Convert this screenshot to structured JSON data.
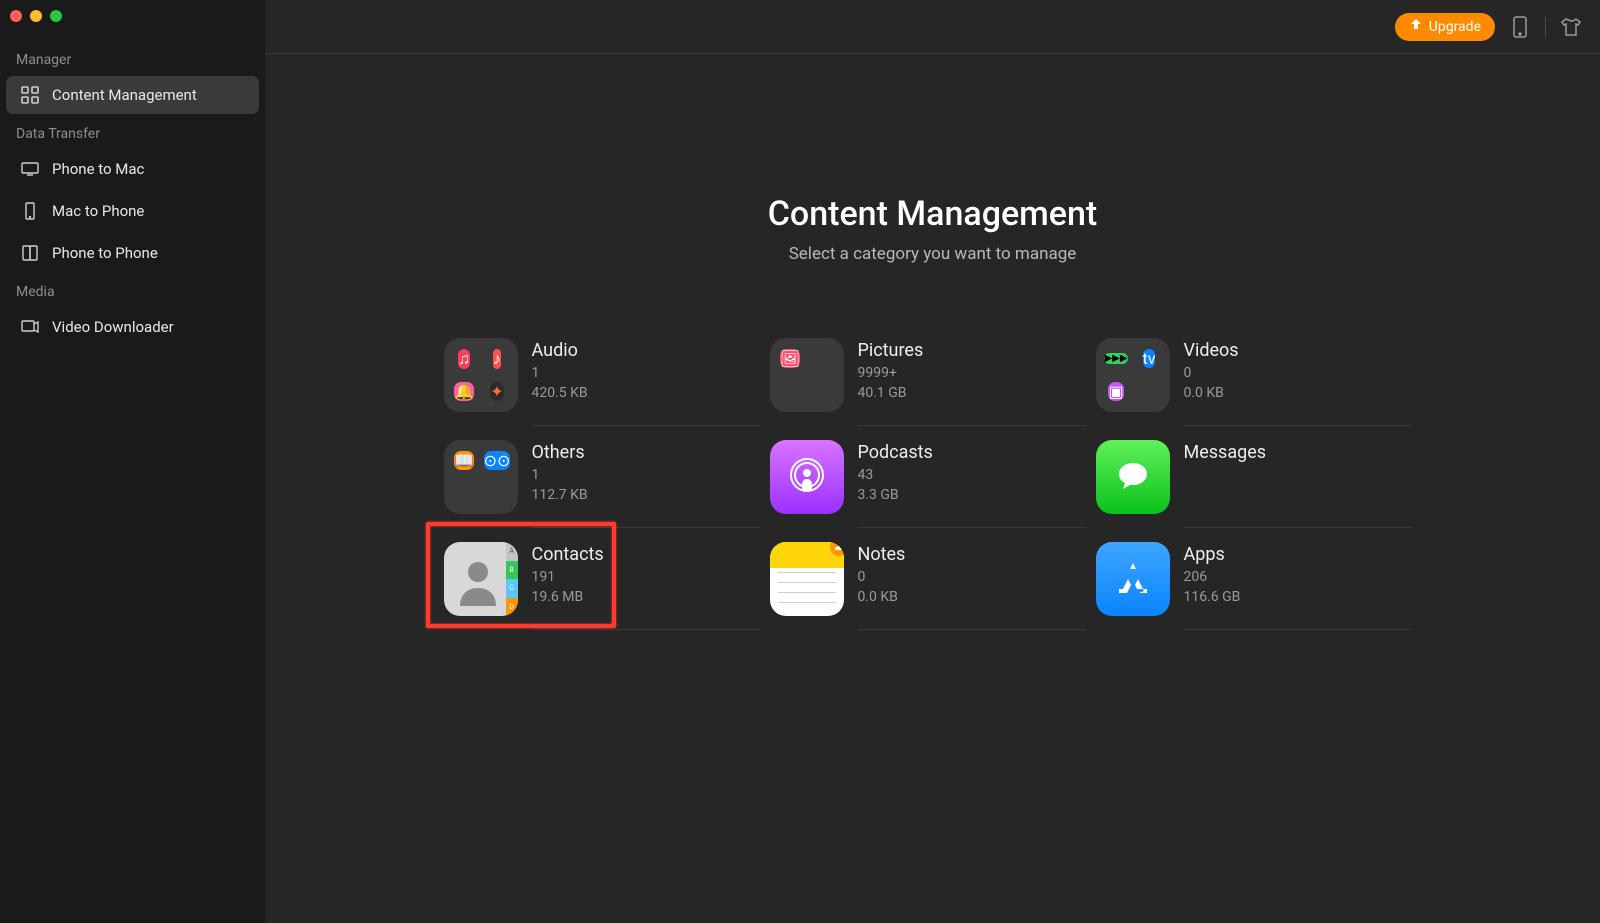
{
  "sidebar": {
    "sections": [
      {
        "title": "Manager",
        "items": [
          {
            "label": "Content Management",
            "active": true
          }
        ]
      },
      {
        "title": "Data Transfer",
        "items": [
          {
            "label": "Phone to Mac"
          },
          {
            "label": "Mac to Phone"
          },
          {
            "label": "Phone to Phone"
          }
        ]
      },
      {
        "title": "Media",
        "items": [
          {
            "label": "Video Downloader"
          }
        ]
      }
    ]
  },
  "topbar": {
    "upgrade_label": "Upgrade"
  },
  "main": {
    "title": "Content Management",
    "subtitle": "Select a category you want to manage"
  },
  "categories": {
    "audio": {
      "title": "Audio",
      "count": "1",
      "size": "420.5 KB"
    },
    "pictures": {
      "title": "Pictures",
      "count": "9999+",
      "size": "40.1 GB"
    },
    "videos": {
      "title": "Videos",
      "count": "0",
      "size": "0.0 KB"
    },
    "others": {
      "title": "Others",
      "count": "1",
      "size": "112.7 KB"
    },
    "podcasts": {
      "title": "Podcasts",
      "count": "43",
      "size": "3.3 GB"
    },
    "messages": {
      "title": "Messages"
    },
    "contacts": {
      "title": "Contacts",
      "count": "191",
      "size": "19.6 MB"
    },
    "notes": {
      "title": "Notes",
      "count": "0",
      "size": "0.0 KB"
    },
    "apps": {
      "title": "Apps",
      "count": "206",
      "size": "116.6 GB"
    }
  },
  "highlighted_category": "contacts"
}
